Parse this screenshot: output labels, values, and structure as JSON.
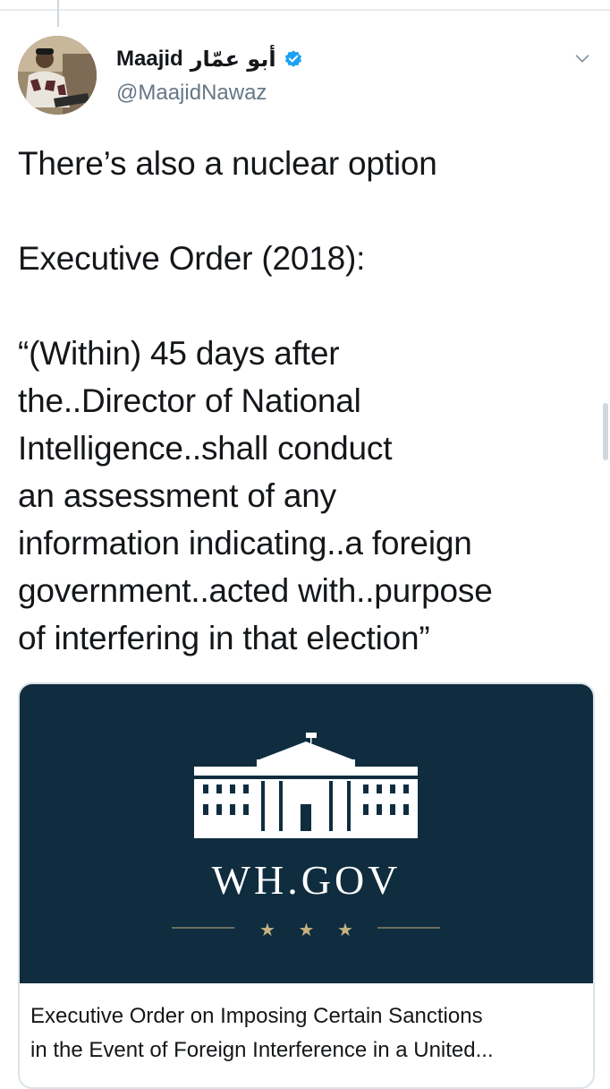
{
  "tweet": {
    "author": {
      "display_name": "Maajid",
      "display_name_arabic": "أبو عمّار",
      "handle": "@MaajidNawaz",
      "verified": true,
      "verified_color": "#1da1f2"
    },
    "text": "There’s also a nuclear option\n\nExecutive Order (2018):\n\n“(Within) 45 days after\nthe..Director of National\nIntelligence..shall conduct\nan assessment of any\ninformation indicating..a foreign\ngovernment..acted with..purpose\nof interfering in that election”"
  },
  "card": {
    "image": {
      "logo_text": "WH.GOV",
      "background_color": "#0f2d3f",
      "icon": "white-house-icon"
    },
    "title": "Executive Order on Imposing Certain Sanctions\nin the Event of Foreign Interference in a United..."
  },
  "icons": {
    "menu": "chevron-down-icon",
    "verified": "verified-badge-icon"
  }
}
